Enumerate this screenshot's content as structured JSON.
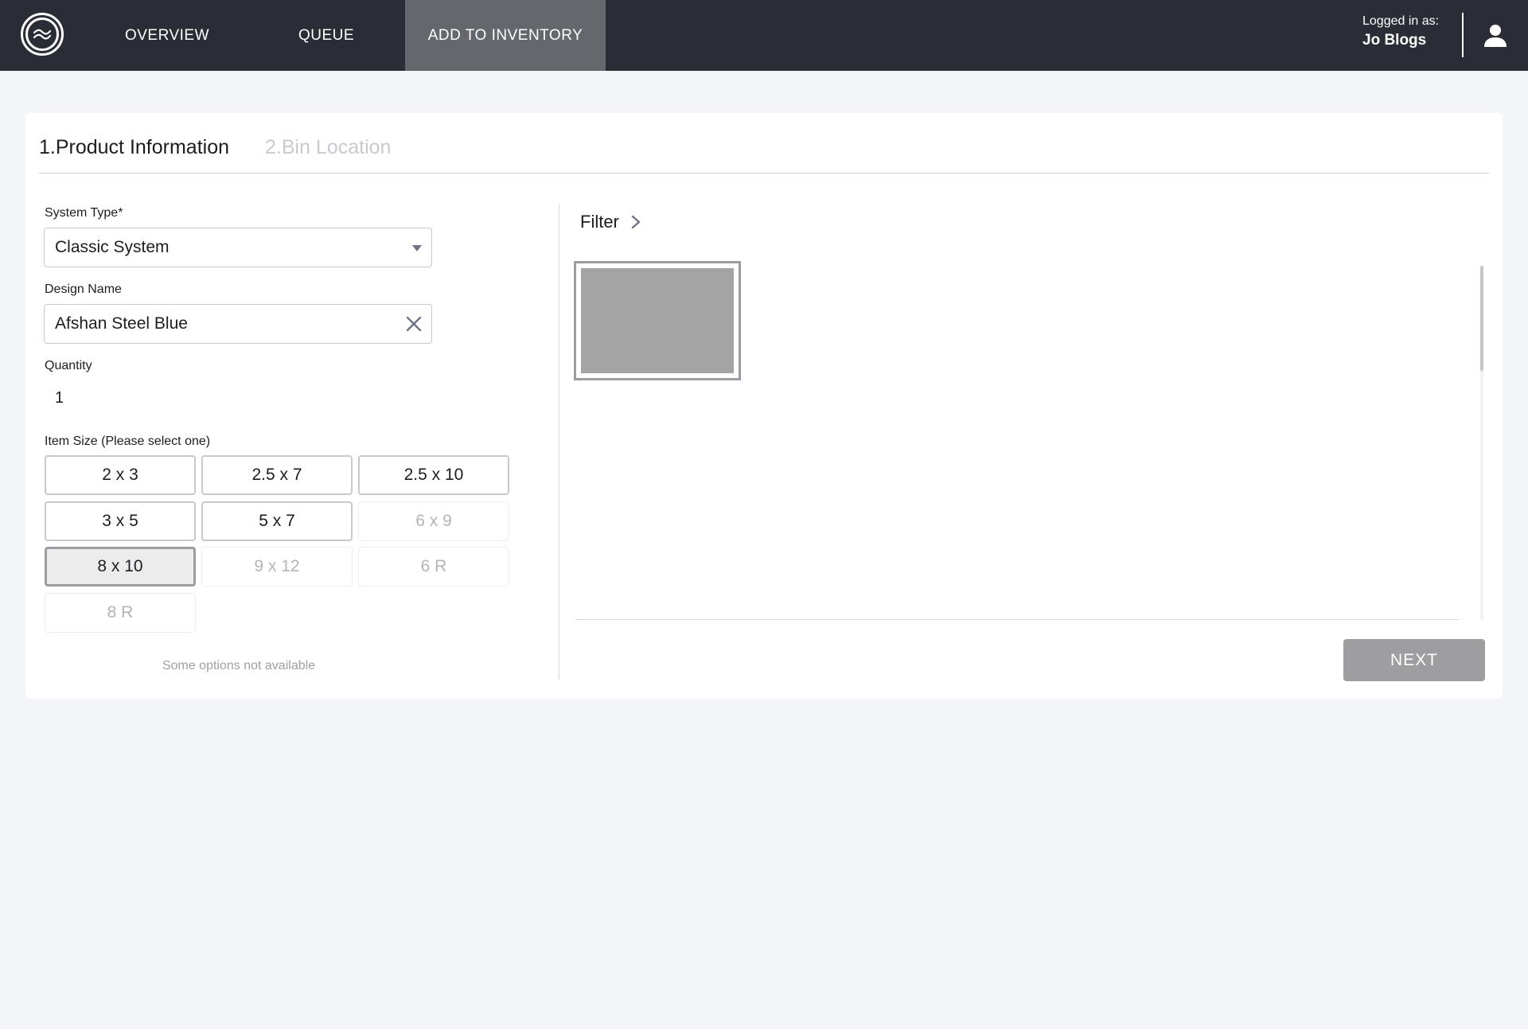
{
  "nav": {
    "tabs": [
      {
        "label": "OVERVIEW",
        "active": false
      },
      {
        "label": "QUEUE",
        "active": false
      },
      {
        "label": "ADD TO INVENTORY",
        "active": true
      }
    ],
    "user": {
      "caption": "Logged in as:",
      "name": "Jo Blogs"
    }
  },
  "steps": [
    {
      "label": "1.Product Information",
      "active": true
    },
    {
      "label": "2.Bin Location",
      "active": false
    }
  ],
  "form": {
    "system_type": {
      "label": "System Type*",
      "value": "Classic System"
    },
    "design_name": {
      "label": "Design Name",
      "value": "Afshan Steel Blue"
    },
    "quantity": {
      "label": "Quantity",
      "value": "1"
    },
    "item_size": {
      "label": "Item Size (Please select one)",
      "options": [
        {
          "label": "2 x 3",
          "state": "available"
        },
        {
          "label": "2.5 x 7",
          "state": "available"
        },
        {
          "label": "2.5 x 10",
          "state": "available"
        },
        {
          "label": "3 x 5",
          "state": "available"
        },
        {
          "label": "5 x 7",
          "state": "available"
        },
        {
          "label": "6 x 9",
          "state": "disabled"
        },
        {
          "label": "8 x 10",
          "state": "selected"
        },
        {
          "label": "9 x 12",
          "state": "disabled"
        },
        {
          "label": "6 R",
          "state": "disabled"
        },
        {
          "label": "8 R",
          "state": "disabled"
        }
      ],
      "hint": "Some options not available"
    }
  },
  "gallery": {
    "filter_label": "Filter",
    "scroll_position": 0
  },
  "actions": {
    "next_label": "NEXT"
  },
  "colors": {
    "nav_bg": "#2a2d35",
    "nav_active": "#66676c",
    "page_bg": "#f4f5f8",
    "next_button": "#9e9ea0",
    "thumbnail_fill": "#a4a4a4"
  },
  "icons": {
    "logo": "waves-logo-icon",
    "user": "user-icon",
    "clear": "close-icon",
    "dropdown": "caret-down-icon",
    "filter": "chevron-right-icon"
  }
}
